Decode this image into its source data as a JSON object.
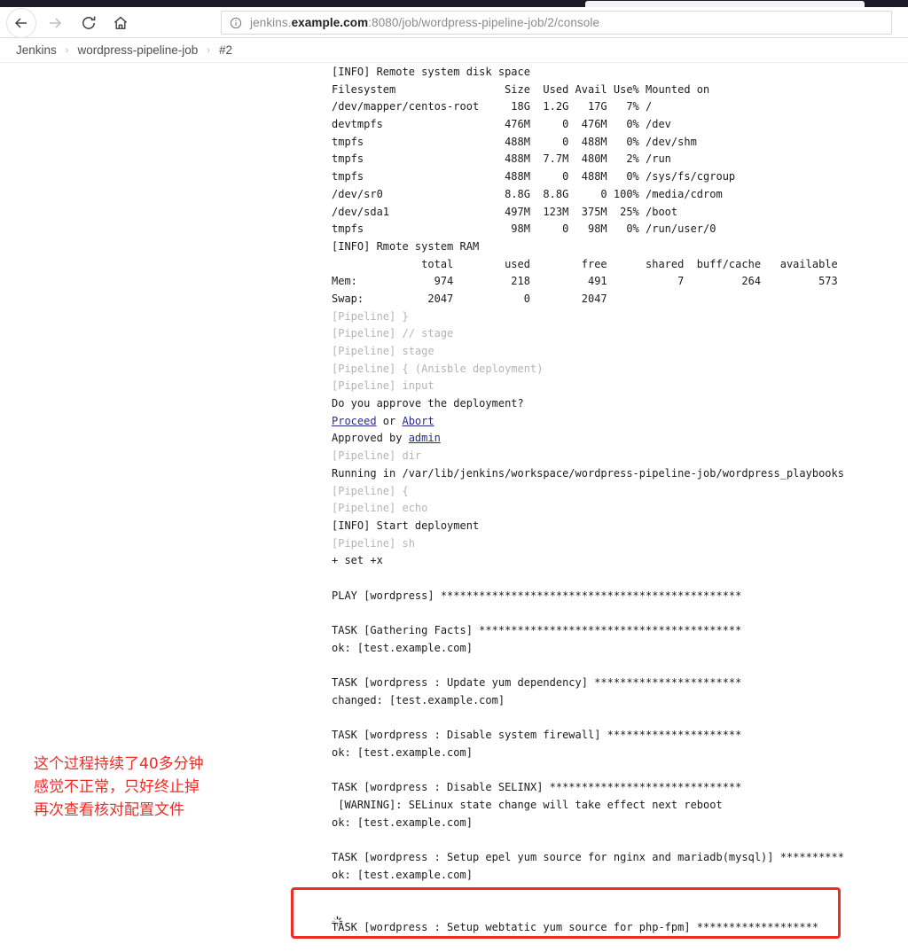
{
  "browser": {
    "back_icon": "back-arrow-icon",
    "forward_icon": "forward-arrow-icon",
    "reload_icon": "reload-icon",
    "home_icon": "home-icon",
    "info_icon": "page-info-icon",
    "url_prefix": "jenkins.",
    "url_host_strong": "example.com",
    "url_suffix": ":8080/job/wordpress-pipeline-job/2/console",
    "url_full": "jenkins.example.com:8080/job/wordpress-pipeline-job/2/console"
  },
  "breadcrumb": {
    "separator": "›",
    "items": [
      {
        "label": "Jenkins"
      },
      {
        "label": "wordpress-pipeline-job"
      },
      {
        "label": "#2"
      }
    ]
  },
  "console": {
    "lines": [
      {
        "text": "[INFO] Remote system disk space",
        "style": "normal"
      },
      {
        "text": "Filesystem                 Size  Used Avail Use% Mounted on",
        "style": "normal"
      },
      {
        "text": "/dev/mapper/centos-root     18G  1.2G   17G   7% /",
        "style": "normal"
      },
      {
        "text": "devtmpfs                   476M     0  476M   0% /dev",
        "style": "normal"
      },
      {
        "text": "tmpfs                      488M     0  488M   0% /dev/shm",
        "style": "normal"
      },
      {
        "text": "tmpfs                      488M  7.7M  480M   2% /run",
        "style": "normal"
      },
      {
        "text": "tmpfs                      488M     0  488M   0% /sys/fs/cgroup",
        "style": "normal"
      },
      {
        "text": "/dev/sr0                   8.8G  8.8G     0 100% /media/cdrom",
        "style": "normal"
      },
      {
        "text": "/dev/sda1                  497M  123M  375M  25% /boot",
        "style": "normal"
      },
      {
        "text": "tmpfs                       98M     0   98M   0% /run/user/0",
        "style": "normal"
      },
      {
        "text": "[INFO] Rmote system RAM",
        "style": "normal"
      },
      {
        "text": "              total        used        free      shared  buff/cache   available",
        "style": "normal"
      },
      {
        "text": "Mem:            974         218         491           7         264         573",
        "style": "normal"
      },
      {
        "text": "Swap:          2047           0        2047",
        "style": "normal"
      },
      {
        "text": "[Pipeline] }",
        "style": "pipeline"
      },
      {
        "text": "[Pipeline] // stage",
        "style": "pipeline"
      },
      {
        "text": "[Pipeline] stage",
        "style": "pipeline"
      },
      {
        "text": "[Pipeline] { (Anisble deployment)",
        "style": "pipeline"
      },
      {
        "text": "[Pipeline] input",
        "style": "pipeline"
      },
      {
        "text": "Do you approve the deployment?",
        "style": "normal"
      },
      {
        "style": "links",
        "segments": [
          {
            "text": "Proceed",
            "link": true
          },
          {
            "text": " or ",
            "link": false
          },
          {
            "text": "Abort",
            "link": true
          }
        ]
      },
      {
        "style": "links",
        "segments": [
          {
            "text": "Approved by ",
            "link": false
          },
          {
            "text": "admin",
            "link": true
          }
        ]
      },
      {
        "text": "[Pipeline] dir",
        "style": "pipeline"
      },
      {
        "text": "Running in /var/lib/jenkins/workspace/wordpress-pipeline-job/wordpress_playbooks",
        "style": "normal"
      },
      {
        "text": "[Pipeline] {",
        "style": "pipeline"
      },
      {
        "text": "[Pipeline] echo",
        "style": "pipeline"
      },
      {
        "text": "[INFO] Start deployment",
        "style": "normal"
      },
      {
        "text": "[Pipeline] sh",
        "style": "pipeline"
      },
      {
        "text": "+ set +x",
        "style": "normal"
      },
      {
        "text": "",
        "style": "blank"
      },
      {
        "text": "PLAY [wordpress] ***********************************************",
        "style": "normal"
      },
      {
        "text": "",
        "style": "blank"
      },
      {
        "text": "TASK [Gathering Facts] *****************************************",
        "style": "normal"
      },
      {
        "text": "ok: [test.example.com]",
        "style": "normal"
      },
      {
        "text": "",
        "style": "blank"
      },
      {
        "text": "TASK [wordpress : Update yum dependency] ***********************",
        "style": "normal"
      },
      {
        "text": "changed: [test.example.com]",
        "style": "normal"
      },
      {
        "text": "",
        "style": "blank"
      },
      {
        "text": "TASK [wordpress : Disable system firewall] *********************",
        "style": "normal"
      },
      {
        "text": "ok: [test.example.com]",
        "style": "normal"
      },
      {
        "text": "",
        "style": "blank"
      },
      {
        "text": "TASK [wordpress : Disable SELINX] ******************************",
        "style": "normal"
      },
      {
        "text": " [WARNING]: SELinux state change will take effect next reboot",
        "style": "normal"
      },
      {
        "text": "ok: [test.example.com]",
        "style": "normal"
      },
      {
        "text": "",
        "style": "blank"
      },
      {
        "text": "TASK [wordpress : Setup epel yum source for nginx and mariadb(mysql)] **********",
        "style": "normal"
      },
      {
        "text": "ok: [test.example.com]",
        "style": "normal"
      },
      {
        "text": "",
        "style": "blank"
      },
      {
        "text": "",
        "style": "blank"
      },
      {
        "text": "TASK [wordpress : Setup webtatic yum source for php-fpm] *******************",
        "style": "normal"
      }
    ]
  },
  "annotation": {
    "text": "这个过程持续了40多分钟\n感觉不正常，只好终止掉\n再次查看核对配置文件",
    "color": "#ef2b26"
  },
  "highlight": {
    "color": "#ee2d24"
  },
  "spinner": {
    "icon": "loading-spinner-icon"
  }
}
